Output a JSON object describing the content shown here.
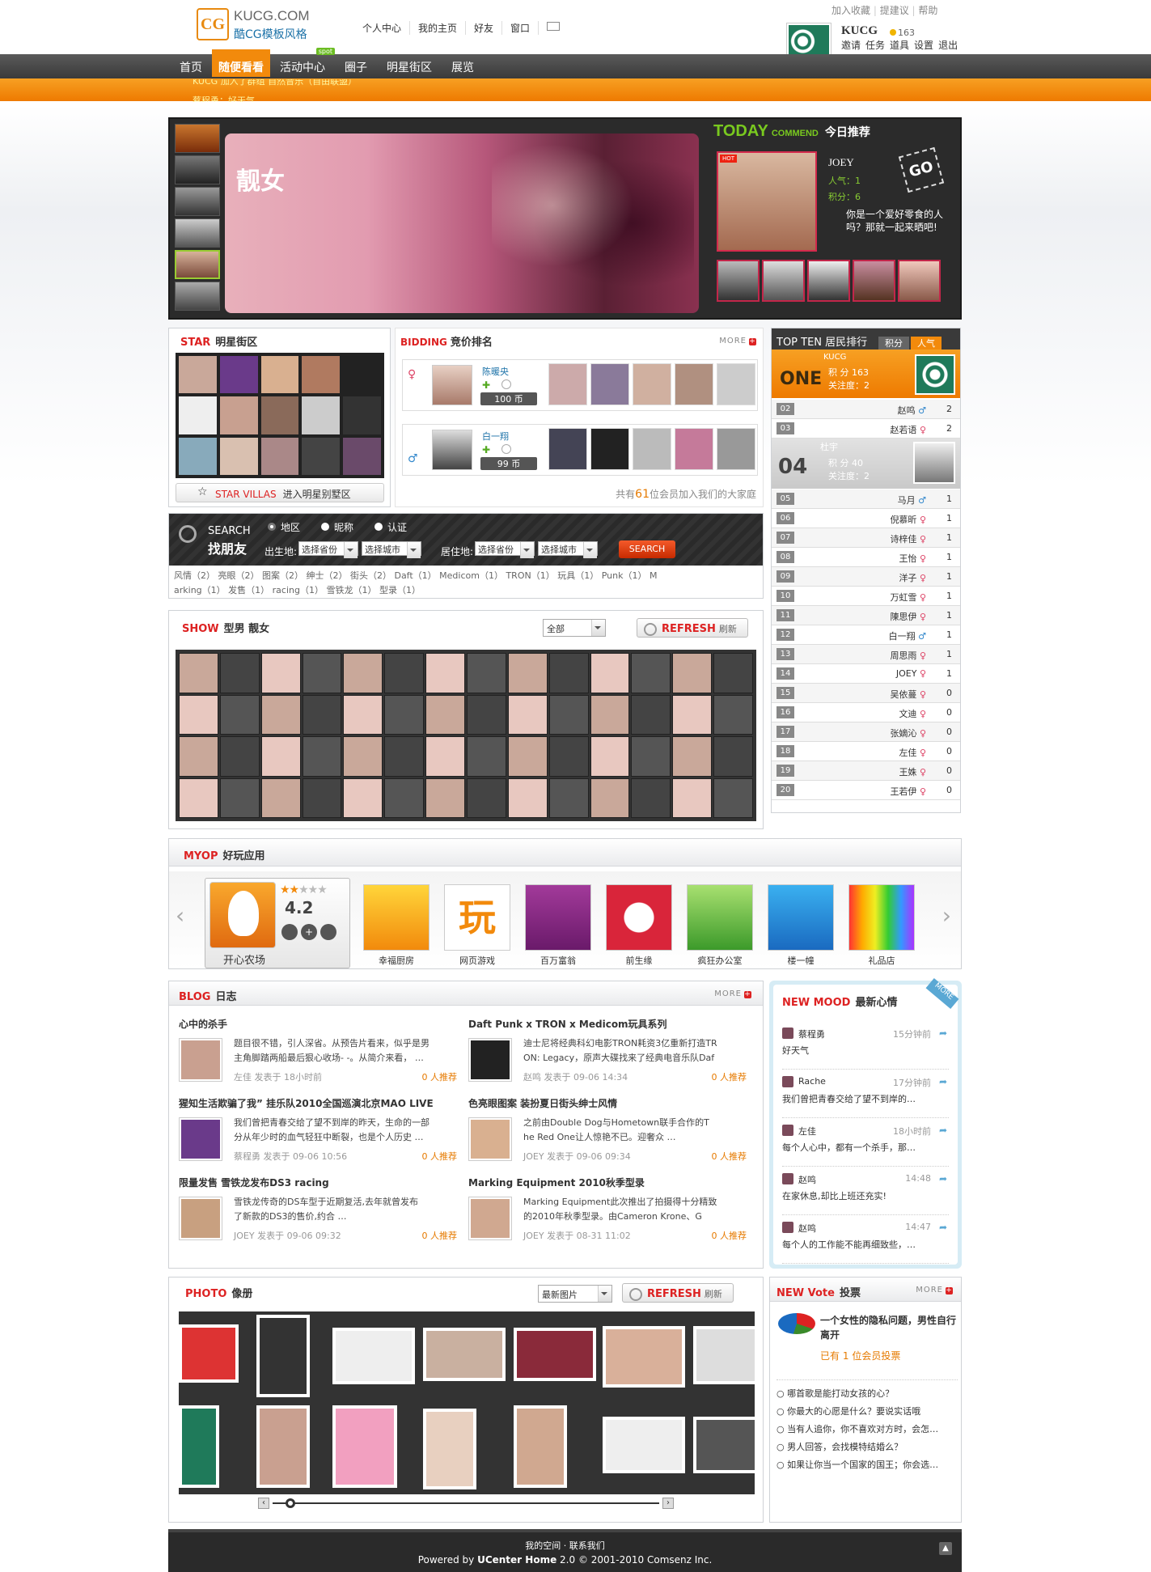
{
  "header": {
    "logo_en": "KUCG.COM",
    "logo_cn": "酷CG模板风格",
    "nav": [
      "个人中心",
      "我的主页",
      "好友",
      "窗口"
    ],
    "top_links": [
      "加入收藏",
      "提建议",
      "帮助"
    ],
    "user_name": "KUCG",
    "user_coins": "163",
    "user_links": [
      "邀请",
      "任务",
      "道具",
      "设置",
      "退出"
    ]
  },
  "mainnav": {
    "items": [
      "首页",
      "随便看看",
      "活动中心",
      "圈子",
      "明星街区",
      "展览"
    ],
    "active_index": 1,
    "badge": "spot",
    "sub1": "KUCG 加入了群组 自然音乐（自由联盟）",
    "sub2": "蔡程勇：好天气"
  },
  "banner": {
    "title": "靓女",
    "today": "TODAY",
    "commend": "COMMEND",
    "today_cn": "今日推荐",
    "name": "JOEY",
    "pop_label": "人气：",
    "pop_val": "1",
    "score_label": "积分：",
    "score_val": "6",
    "desc": "你是一个爱好零食的人吗？那就一起来晒吧!",
    "hot": "HOT",
    "go": "GO"
  },
  "star": {
    "en": "STAR",
    "cn": "明星街区",
    "villas_en": "STAR VILLAS",
    "villas_cn": "进入明星别墅区"
  },
  "bidding": {
    "en": "BIDDING",
    "cn": "竞价排名",
    "more": "MORE",
    "names": [
      "陈暖央",
      "白一翔"
    ],
    "prices": [
      "100 币",
      "99 币"
    ],
    "footer_a": "共有",
    "footer_n": "61",
    "footer_b": "位会员加入我们的大家庭"
  },
  "topten": {
    "title": "TOP TEN 居民排行",
    "tab1": "积分",
    "tab2": "人气",
    "one_label": "ONE",
    "one_name": "KUCG",
    "one_score": "积 分 163",
    "one_focus": "关注度：2",
    "four_label": "04",
    "four_name": "杜宇",
    "four_score": "积 分 40",
    "four_focus": "关注度：2",
    "rows": [
      {
        "n": "02",
        "name": "赵鸣",
        "s": "m",
        "v": "2"
      },
      {
        "n": "03",
        "name": "赵若语",
        "s": "f",
        "v": "2"
      },
      {
        "n": "05",
        "name": "马月",
        "s": "m",
        "v": "1"
      },
      {
        "n": "06",
        "name": "倪慕昕",
        "s": "f",
        "v": "1"
      },
      {
        "n": "07",
        "name": "诗梓佳",
        "s": "f",
        "v": "1"
      },
      {
        "n": "08",
        "name": "王怡",
        "s": "f",
        "v": "1"
      },
      {
        "n": "09",
        "name": "洋子",
        "s": "f",
        "v": "1"
      },
      {
        "n": "10",
        "name": "万虹雪",
        "s": "f",
        "v": "1"
      },
      {
        "n": "11",
        "name": "陳思伊",
        "s": "f",
        "v": "1"
      },
      {
        "n": "12",
        "name": "白一翔",
        "s": "m",
        "v": "1"
      },
      {
        "n": "13",
        "name": "周思雨",
        "s": "f",
        "v": "1"
      },
      {
        "n": "14",
        "name": "JOEY",
        "s": "f",
        "v": "1"
      },
      {
        "n": "15",
        "name": "吴依蔓",
        "s": "f",
        "v": "0"
      },
      {
        "n": "16",
        "name": "文迪",
        "s": "f",
        "v": "0"
      },
      {
        "n": "17",
        "name": "张嫡沁",
        "s": "f",
        "v": "0"
      },
      {
        "n": "18",
        "name": "左佳",
        "s": "f",
        "v": "0"
      },
      {
        "n": "19",
        "name": "王姝",
        "s": "f",
        "v": "0"
      },
      {
        "n": "20",
        "name": "王若伊",
        "s": "f",
        "v": "0"
      }
    ]
  },
  "search": {
    "en": "SEARCH",
    "cn": "找朋友",
    "opt1": "地区",
    "opt2": "昵称",
    "opt3": "认证",
    "born": "出生地:",
    "live": "居住地:",
    "prov": "选择省份",
    "city": "选择城市",
    "btn": "SEARCH",
    "tags_line1": "风情（2） 亮眼（2） 图案（2） 绅士（2） 街头（2） Daft（1） Medicom（1） TRON（1） 玩具（1） Punk（1） M",
    "tags_line2": "arking（1） 发售（1） racing（1） 雪铁龙（1） 型录（1）"
  },
  "show": {
    "en": "SHOW",
    "cn": "型男 靓女",
    "filter": "全部",
    "refresh": "REFRESH",
    "refresh_cn": "刷新"
  },
  "myop": {
    "en": "MYOP",
    "cn": "好玩应用",
    "featured": "开心农场",
    "rating": "4.2",
    "apps": [
      "幸福厨房",
      "网页游戏",
      "百万富翁",
      "前生缘",
      "疯狂办公室",
      "楼一幢",
      "礼品店"
    ]
  },
  "blog": {
    "en": "BLOG",
    "cn": "日志",
    "more": "MORE",
    "rec": "0 人推荐",
    "posted": "发表于",
    "items": [
      {
        "title": "心中的杀手",
        "body1": "题目很不错，引人深省。从预告片看来，似乎是男",
        "body2": "主角脚踏两船最后狠心收场- -。从简介来看，  …",
        "author": "左佳",
        "time": "18小时前"
      },
      {
        "title": "Daft Punk x TRON x Medicom玩具系列",
        "body1": "迪士尼将经典科幻电影TRON耗资3亿重新打造TR",
        "body2": "ON: Legacy，原声大碟找来了经典电音乐队Daf",
        "author": "赵鸣",
        "time": "09-06 14:34"
      },
      {
        "title": "猩知生活欺骗了我” 挂乐队2010全国巡演北京MAO LIVE",
        "body1": "我们曾把青春交给了望不到岸的昨天，生命的一部",
        "body2": "分从年少时的血气轻狂中断裂，也是个人历史  …",
        "author": "蔡程勇",
        "time": "09-06 10:56"
      },
      {
        "title": "色亮眼图案 装扮夏日街头绅士风情",
        "body1": "之前由Double Dog与Hometown联手合作的T",
        "body2": "he Red One让人惊艳不已。迎奢众  …",
        "author": "JOEY",
        "time": "09-06 09:34"
      },
      {
        "title": "限量发售 雪铁龙发布DS3 racing",
        "body1": "雪铁龙传奇的DS车型于近期复活,去年就曾发布",
        "body2": "了新款的DS3的售价,约合  …",
        "author": "JOEY",
        "time": "09-06 09:32"
      },
      {
        "title": "Marking Equipment 2010秋季型录",
        "body1": "Marking Equipment此次推出了拍摄得十分精致",
        "body2": "的2010年秋季型录。由Cameron Krone、G",
        "author": "JOEY",
        "time": "08-31 11:02"
      }
    ]
  },
  "mood": {
    "en": "NEW MOOD",
    "cn": "最新心情",
    "more": "MORE",
    "items": [
      {
        "name": "蔡程勇",
        "time": "15分钟前",
        "text": "好天气"
      },
      {
        "name": "Rache",
        "time": "17分钟前",
        "text": "我们曾把青春交给了望不到岸的…"
      },
      {
        "name": "左佳",
        "time": "18小时前",
        "text": "每个人心中，都有一个杀手，那…"
      },
      {
        "name": "赵鸣",
        "time": "14:48",
        "text": "在家休息,却比上班还充实!"
      },
      {
        "name": "赵鸣",
        "time": "14:47",
        "text": "每个人的工作能不能再细致些，…"
      }
    ]
  },
  "photo": {
    "en": "PHOTO",
    "cn": "像册",
    "filter": "最新图片",
    "refresh": "REFRESH",
    "refresh_cn": "刷新"
  },
  "vote": {
    "en": "NEW Vote",
    "cn": "投票",
    "more": "MORE",
    "main": "一个女性的隐私问题，男性自行离开",
    "joined_a": "已有",
    "joined_n": "1",
    "joined_b": "位会员投票",
    "items": [
      "哪首歌是能打动女孩的心？",
      "你最大的心愿是什么？要说实话哦",
      "当有人追你，你不喜欢对方时，会怎…",
      "男人回答，会找模特结婚么？",
      "如果让你当一个国家的国王；你会选…"
    ]
  },
  "footer": {
    "links": "我的空间 · 联系我们",
    "powered": "Powered by",
    "product": "UCenter Home",
    "ver": "2.0 © 2001-2010 Comsenz Inc."
  }
}
